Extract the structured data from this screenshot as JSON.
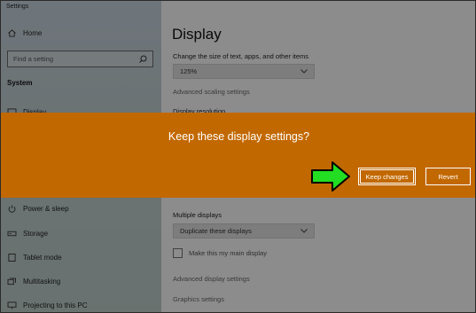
{
  "window": {
    "title": "Settings"
  },
  "sidebar": {
    "home_label": "Home",
    "search_placeholder": "Find a setting",
    "section_title": "System",
    "items": [
      {
        "label": "Display",
        "icon": "monitor-icon"
      },
      {
        "label": "Power & sleep",
        "icon": "power-icon"
      },
      {
        "label": "Storage",
        "icon": "storage-icon"
      },
      {
        "label": "Tablet mode",
        "icon": "tablet-icon"
      },
      {
        "label": "Multitasking",
        "icon": "multitasking-icon"
      },
      {
        "label": "Projecting to this PC",
        "icon": "projecting-icon"
      }
    ]
  },
  "main": {
    "title": "Display",
    "scale_label": "Change the size of text, apps, and other items",
    "scale_value": "125%",
    "advanced_scaling_link": "Advanced scaling settings",
    "resolution_label": "Display resolution",
    "multiple_displays_label": "Multiple displays",
    "multiple_displays_value": "Duplicate these displays",
    "main_display_checkbox": "Make this my main display",
    "advanced_display_link": "Advanced display settings",
    "graphics_link": "Graphics settings"
  },
  "dialog": {
    "message": "Keep these display settings?",
    "keep_label": "Keep changes",
    "revert_label": "Revert",
    "accent_color": "#c26800"
  },
  "annotation": {
    "arrow_color": "#22dd22"
  }
}
